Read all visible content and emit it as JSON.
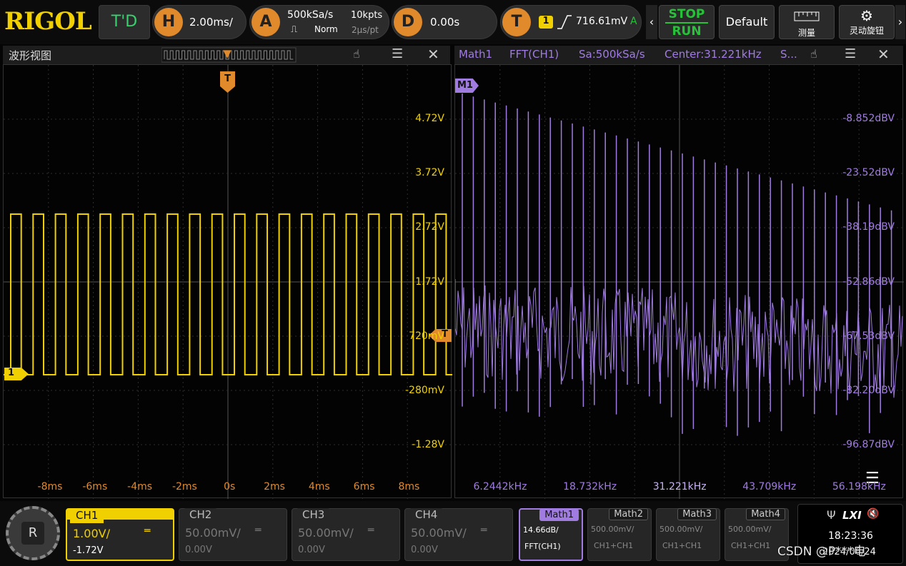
{
  "logo": "RIGOL",
  "mode": "T'D",
  "horizontal": {
    "letter": "H",
    "value": "2.00ms/"
  },
  "acquire": {
    "letter": "A",
    "rate": "500kSa/s",
    "depth": "10kpts",
    "mode": "Norm",
    "interval": "2μs/pt"
  },
  "delay": {
    "letter": "D",
    "value": "0.00s"
  },
  "trigger": {
    "letter": "T",
    "channel": "1",
    "level": "716.61mV",
    "state": "A"
  },
  "stop_label": "STOP",
  "run_label": "RUN",
  "default_label": "Default",
  "measure_label": "测量",
  "knob_label": "灵动旋钮",
  "waveform_panel": {
    "title": "波形视图",
    "trigger_marker": "T",
    "channel_marker": "1",
    "trigger_level_label": "T",
    "v_labels": [
      "4.72V",
      "3.72V",
      "2.72V",
      "1.72V",
      "720mV",
      "-280mV",
      "-1.28V"
    ],
    "t_labels": [
      "-8ms",
      "-6ms",
      "-4ms",
      "-2ms",
      "0s",
      "2ms",
      "4ms",
      "6ms",
      "8ms"
    ]
  },
  "fft_panel": {
    "title": "Math1",
    "func": "FFT(CH1)",
    "rate": "Sa:500kSa/s",
    "center": "Center:31.221kHz",
    "span": "S...",
    "marker": "M1",
    "db_labels": [
      "-8.852dBV",
      "-23.52dBV",
      "-38.19dBV",
      "-52.86dBV",
      "-67.53dBV",
      "-82.20dBV",
      "-96.87dBV"
    ],
    "f_labels": [
      "6.2442kHz",
      "18.732kHz",
      "31.221kHz",
      "43.709kHz",
      "56.198kHz"
    ]
  },
  "channels": [
    {
      "name": "CH1",
      "scale": "1.00V/",
      "offset": "-1.72V"
    },
    {
      "name": "CH2",
      "scale": "50.00mV/",
      "offset": "0.00V"
    },
    {
      "name": "CH3",
      "scale": "50.00mV/",
      "offset": "0.00V"
    },
    {
      "name": "CH4",
      "scale": "50.00mV/",
      "offset": "0.00V"
    }
  ],
  "maths": [
    {
      "name": "Math1",
      "scale": "14.66dB/",
      "source": "FFT(CH1)"
    },
    {
      "name": "Math2",
      "scale": "500.00mV/",
      "source": "CH1+CH1"
    },
    {
      "name": "Math3",
      "scale": "500.00mV/",
      "source": "CH1+CH1"
    },
    {
      "name": "Math4",
      "scale": "500.00mV/",
      "source": "CH1+CH1"
    }
  ],
  "status": {
    "usb": "Ψ",
    "lxi": "LXI",
    "mute": "🔇",
    "time": "18:23:36",
    "date": "2024/06/24"
  },
  "watermark": "CSDN @P***电",
  "colors": {
    "ch1": "#f0d000",
    "math": "#a07ce0",
    "trigger": "#e08a2c",
    "run": "#27c23a"
  }
}
